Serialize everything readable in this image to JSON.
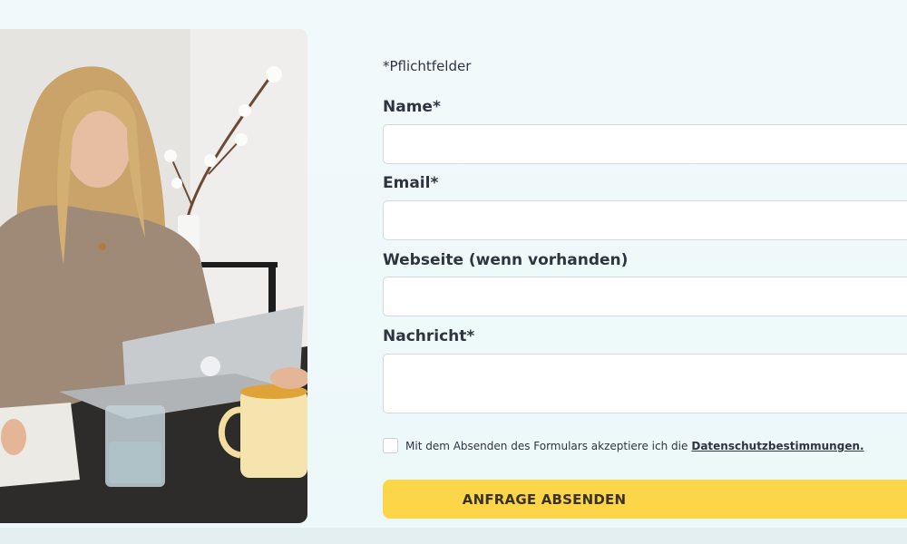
{
  "form": {
    "required_note": "*Pflichtfelder",
    "fields": [
      {
        "label": "Name*",
        "value": "",
        "placeholder": ""
      },
      {
        "label": "Email*",
        "value": "",
        "placeholder": ""
      },
      {
        "label": "Webseite (wenn vorhanden)",
        "value": "",
        "placeholder": ""
      },
      {
        "label": "Nachricht*",
        "value": "",
        "placeholder": ""
      }
    ],
    "consent_text": "Mit dem Absenden des Formulars akzeptiere ich die",
    "consent_link": "Datenschutzbestimmungen.",
    "consent_checked": false,
    "submit_label": "ANFRAGE ABSENDEN"
  },
  "colors": {
    "background": "#eef9fa",
    "button": "#fdd549",
    "text": "#2f3540"
  }
}
